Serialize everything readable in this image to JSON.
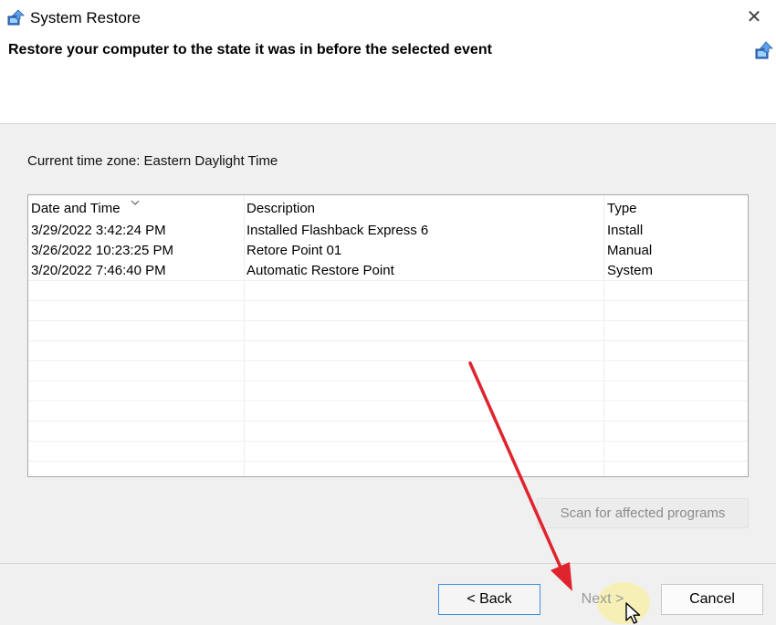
{
  "window": {
    "title": "System Restore",
    "close_glyph": "✕",
    "app_icon": "system-restore-icon"
  },
  "header": {
    "title": "Restore your computer to the state it was in before the selected event",
    "icon": "system-restore-icon"
  },
  "timezone": "Current time zone: Eastern Daylight Time",
  "table": {
    "columns": [
      "Date and Time",
      "Description",
      "Type"
    ],
    "sort_icon": "sort-down-chevron-icon",
    "rows": [
      {
        "date": "3/29/2022 3:42:24 PM",
        "description": "Installed Flashback Express 6",
        "type": "Install"
      },
      {
        "date": "3/26/2022 10:23:25 PM",
        "description": "Retore Point 01",
        "type": "Manual"
      },
      {
        "date": "3/20/2022 7:46:40 PM",
        "description": "Automatic Restore Point",
        "type": "System"
      }
    ]
  },
  "buttons": {
    "scan": "Scan for affected programs",
    "back": "< Back",
    "next": "Next >",
    "cancel": "Cancel"
  },
  "colors": {
    "accent_border": "#3f8fe0",
    "annotation_arrow": "#e0242e",
    "disabled_text": "#9a9a9a",
    "cursor_highlight": "#fff06e"
  }
}
